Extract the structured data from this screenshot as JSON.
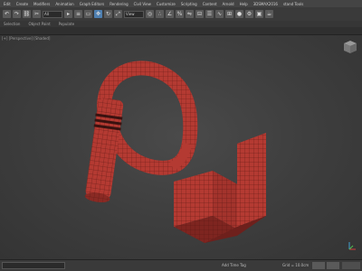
{
  "menu": {
    "items": [
      "Edit",
      "Create",
      "Modifiers",
      "Animation",
      "Graph Editors",
      "Rendering",
      "Civil View",
      "Customize",
      "Scripting",
      "Content",
      "Arnold",
      "Help",
      "3DSMAX2016",
      "stand Tools"
    ]
  },
  "toolbar": {
    "filter_value": "All",
    "view_value": "View"
  },
  "ribbon": {
    "tabs": [
      "Selection",
      "Object Paint",
      "Populate"
    ]
  },
  "viewport": {
    "label": "[+] [Perspective] [Shaded]"
  },
  "status": {
    "grid_text": "Grid = 10.0cm",
    "tag_text": "Add Time Tag"
  },
  "colors": {
    "model": "#b43a32",
    "model_dark": "#7e2520",
    "viewport_bg": "#3e3e3e"
  }
}
